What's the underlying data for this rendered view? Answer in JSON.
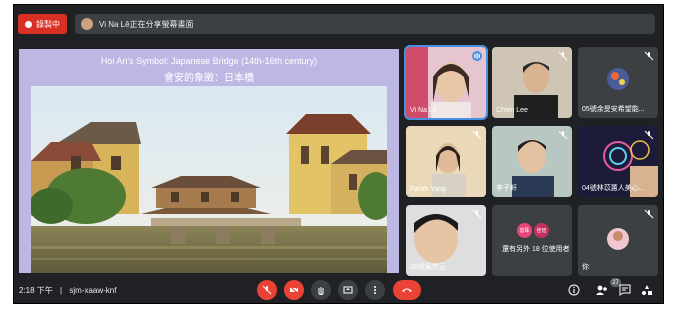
{
  "recording": {
    "label": "錄製中"
  },
  "presenting": {
    "text": "Vi Na Lê正在分享螢幕畫面"
  },
  "slide": {
    "title_en": "Hoi An's Symbol: Japanese Bridge (14th-16th century)",
    "title_zh": "會安的象徵：日本橋"
  },
  "participants": [
    {
      "name": "Vi Na Lê",
      "mic": "speaking"
    },
    {
      "name": "Chien Lee",
      "mic": "muted"
    },
    {
      "name": "05號余旻安希望能...",
      "mic": "muted"
    },
    {
      "name": "Farah Yang",
      "mic": "muted"
    },
    {
      "name": "李子軒",
      "mic": "muted"
    },
    {
      "name": "04號林苡蕙人美心...",
      "mic": "muted"
    },
    {
      "name": "06號吳宗元",
      "mic": "muted"
    },
    {
      "name": "還有另外 18 位使用者",
      "mic": ""
    },
    {
      "name": "你",
      "mic": "muted"
    }
  ],
  "others_avatars": [
    "善珠",
    "佳瑄"
  ],
  "bottom": {
    "time": "2:18 下午",
    "separator": "|",
    "meeting_code": "sjm-xaaw-knf",
    "people_count": "27"
  },
  "colors": {
    "accent": "#4a90e2",
    "danger": "#ea4335",
    "bg": "#202124",
    "tile": "#3c4043",
    "slide": "#bdb8e3"
  },
  "icons": [
    "mic-off-icon",
    "camera-off-icon",
    "hand-icon",
    "present-icon",
    "more-icon",
    "hangup-icon",
    "info-icon",
    "people-icon",
    "chat-icon",
    "activities-icon"
  ]
}
